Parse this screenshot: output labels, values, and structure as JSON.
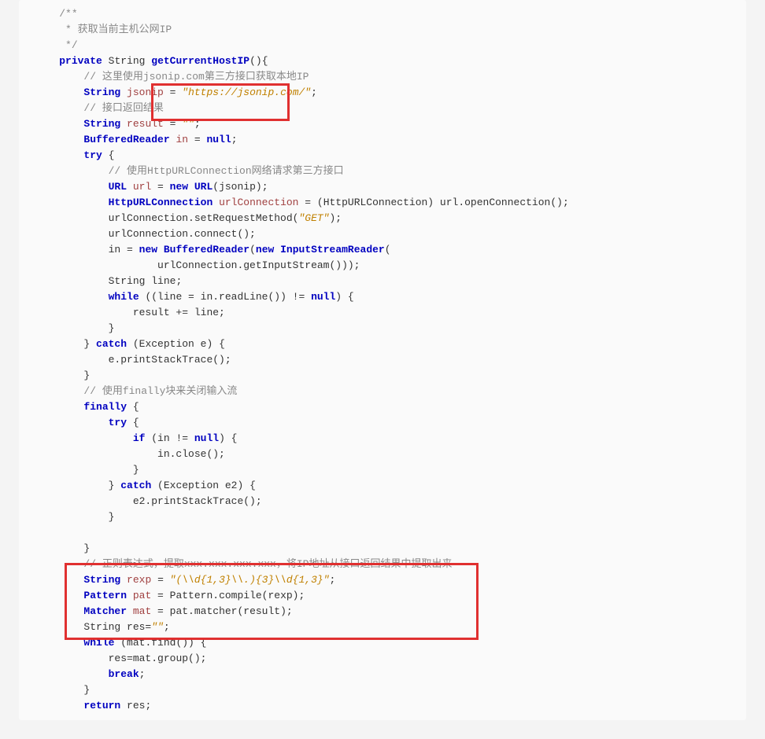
{
  "code": {
    "c1": "/**",
    "c2": " * 获取当前主机公网IP",
    "c3": " */",
    "l1_private": "private",
    "l1_string": "String",
    "l1_fn": "getCurrentHostIP",
    "l1_paren": "(){",
    "c4": "// 这里使用jsonip.com第三方接口获取本地IP",
    "l2_type": "String",
    "l2_var": "jsonip",
    "l2_eq": " = ",
    "l2_str": "\"https://jsonip.com/\"",
    "l2_semi": ";",
    "c5": "// 接口返回结果",
    "l3_type": "String",
    "l3_var": "result",
    "l3_eq": " = ",
    "l3_str": "\"\"",
    "l3_semi": ";",
    "l4_type": "BufferedReader",
    "l4_var": "in",
    "l4_eq": " = ",
    "l4_null": "null",
    "l4_semi": ";",
    "l5_try": "try",
    "l5_brace": " {",
    "c6": "// 使用HttpURLConnection网络请求第三方接口",
    "l6_urltype": "URL",
    "l6_urlvar": "url",
    "l6_eq": " = ",
    "l6_new": "new",
    "l6_urlctor": "URL",
    "l6_tail": "(jsonip);",
    "l7_type": "HttpURLConnection",
    "l7_var": "urlConnection",
    "l7_mid": " = (HttpURLConnection) url.openConnection();",
    "l8": "urlConnection.setRequestMethod(",
    "l8_str": "\"GET\"",
    "l8_tail": ");",
    "l9": "urlConnection.connect();",
    "l10_in": "in = ",
    "l10_new": "new",
    "l10_br": "BufferedReader",
    "l10_paren": "(",
    "l10_new2": "new",
    "l10_isr": "InputStreamReader",
    "l10_tail": "(",
    "l11": "urlConnection.getInputStream()));",
    "l12": "String line;",
    "l13_while": "while",
    "l13_mid": " ((line = in.readLine()) != ",
    "l13_null": "null",
    "l13_tail": ") {",
    "l14": "result += line;",
    "l15": "}",
    "l16": "} ",
    "l16_catch": "catch",
    "l16_tail": " (Exception e) {",
    "l17": "e.printStackTrace();",
    "l18": "}",
    "c7": "// 使用finally块来关闭输入流",
    "l19_fin": "finally",
    "l19_brace": " {",
    "l20_try": "try",
    "l20_brace": " {",
    "l21_if": "if",
    "l21_mid": " (in != ",
    "l21_null": "null",
    "l21_tail": ") {",
    "l22": "in.close();",
    "l23": "}",
    "l24": "} ",
    "l24_catch": "catch",
    "l24_tail": " (Exception e2) {",
    "l25": "e2.printStackTrace();",
    "l26": "}",
    "l27": "}",
    "c8": "// 正则表达式，提取xxx.xxx.xxx.xxx，将IP地址从接口返回结果中提取出来",
    "l28_type": "String",
    "l28_var": "rexp",
    "l28_eq": " = ",
    "l28_str": "\"(\\\\d{1,3}\\\\.){3}\\\\d{1,3}\"",
    "l28_semi": ";",
    "l29_type": "Pattern",
    "l29_var": "pat",
    "l29_tail": " = Pattern.compile(rexp);",
    "l30_type": "Matcher",
    "l30_var": "mat",
    "l30_tail": " = pat.matcher(result);",
    "l31_pre": "String res=",
    "l31_str": "\"\"",
    "l31_semi": ";",
    "l32_while": "while",
    "l32_tail": " (mat.find()) {",
    "l33": "res=mat.group();",
    "l34_break": "break",
    "l34_semi": ";",
    "l35": "}",
    "l36_return": "return",
    "l36_tail": " res;"
  }
}
